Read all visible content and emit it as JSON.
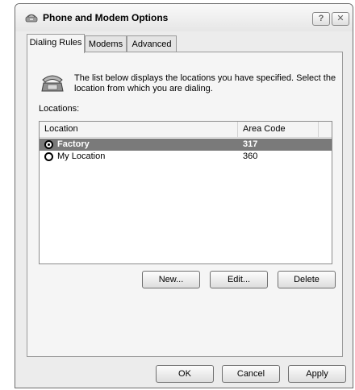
{
  "window": {
    "title": "Phone and Modem Options",
    "help_button": "?",
    "close_button": "✕"
  },
  "tabs": [
    {
      "label": "Dialing Rules",
      "active": true
    },
    {
      "label": "Modems",
      "active": false
    },
    {
      "label": "Advanced",
      "active": false
    }
  ],
  "dialing_rules": {
    "description": "The list below displays the locations you have specified. Select the location from which you are dialing.",
    "locations_label": "Locations:",
    "columns": [
      "Location",
      "Area Code"
    ],
    "rows": [
      {
        "location": "Factory",
        "area_code": "317",
        "selected": true
      },
      {
        "location": "My Location",
        "area_code": "360",
        "selected": false
      }
    ],
    "buttons": {
      "new": "New...",
      "edit": "Edit...",
      "delete": "Delete"
    }
  },
  "footer": {
    "ok": "OK",
    "cancel": "Cancel",
    "apply": "Apply"
  },
  "icons": {
    "title": "phone-modem-icon",
    "location": "telephone-icon"
  },
  "colors": {
    "selection": "#7a7a7a",
    "panel": "#f5f5f5",
    "dialog": "#ececec"
  }
}
